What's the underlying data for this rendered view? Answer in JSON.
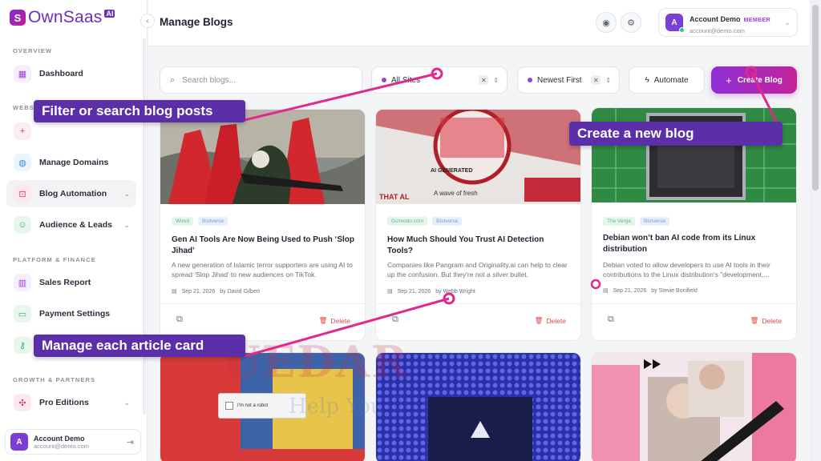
{
  "brand": {
    "name": "OwnSaas",
    "badge": "AI",
    "mark": "S"
  },
  "colors": {
    "accent": "#8b2fd6",
    "accent2": "#c5239a",
    "danger": "#e04848",
    "callout": "#5b2fa8"
  },
  "sidebar": {
    "sections": {
      "overview": "OVERVIEW",
      "websites": "WEBS",
      "platform": "PLATFORM & FINANCE",
      "growth": "GROWTH & PARTNERS"
    },
    "items": [
      {
        "label": "Dashboard",
        "icon": "grid-icon"
      },
      {
        "label": "",
        "icon": "plus-icon"
      },
      {
        "label": "Manage Domains",
        "icon": "globe-icon"
      },
      {
        "label": "Blog Automation",
        "icon": "robot-icon"
      },
      {
        "label": "Audience & Leads",
        "icon": "users-icon"
      },
      {
        "label": "Sales Report",
        "icon": "bar-chart-icon"
      },
      {
        "label": "Payment Settings",
        "icon": "card-icon"
      },
      {
        "label": "",
        "icon": "key-icon"
      },
      {
        "label": "Pro Editions",
        "icon": "star-icon"
      }
    ],
    "user": {
      "initial": "A",
      "name": "Account Demo",
      "email": "account@demo.com"
    }
  },
  "header": {
    "title": "Manage Blogs",
    "account": {
      "initial": "A",
      "name": "Account Demo",
      "badge": "MEMBER",
      "email": "account@demo.com"
    }
  },
  "toolbar": {
    "search_placeholder": "Search blogs...",
    "site_filter": "All Sites",
    "sort": "Newest First",
    "automate_label": "Automate",
    "create_label": "Create Blog"
  },
  "cards": [
    {
      "source": "Wired",
      "category": "Biotverse",
      "title": "Gen AI Tools Are Now Being Used to Push ‘Slop Jihad’",
      "desc": "A new generation of Islamic terror supporters are using AI to spread ‘Slop Jihad’ to new audiences on TikTok.",
      "date": "Sep 21, 2026",
      "author": "by David Gilbert",
      "delete": "Delete"
    },
    {
      "source": "Gizmodo.com",
      "category": "Biotverse",
      "title": "How Much Should You Trust AI Detection Tools?",
      "desc": "Companies like Pangram and Originality.ai can help to clear up the confusion. But they're not a silver bullet.",
      "date": "Sep 21, 2026",
      "author": "by Webb Wright",
      "delete": "Delete",
      "thumb_text_1": "AI GENERATED",
      "thumb_text_2": "A wave of fresh",
      "thumb_text_3": "THAT AL"
    },
    {
      "source": "The Verge",
      "category": "Biotverse",
      "title": "Debian won’t ban AI code from its Linux distribution",
      "desc": "Debian voted to allow developers to use AI tools in their contributions to the Linux distribution's \"development,...",
      "date": "Sep 21, 2026",
      "author": "by Stevie Bonifield",
      "delete": "Delete"
    }
  ],
  "lower_cards": {
    "captcha_text": "I'm not a robot"
  },
  "annotations": {
    "filter": "Filter or search blog posts",
    "create": "Create a new blog",
    "manage": "Manage each article card"
  },
  "watermark": {
    "line1": "UEDAR",
    "line2": "Help You"
  }
}
